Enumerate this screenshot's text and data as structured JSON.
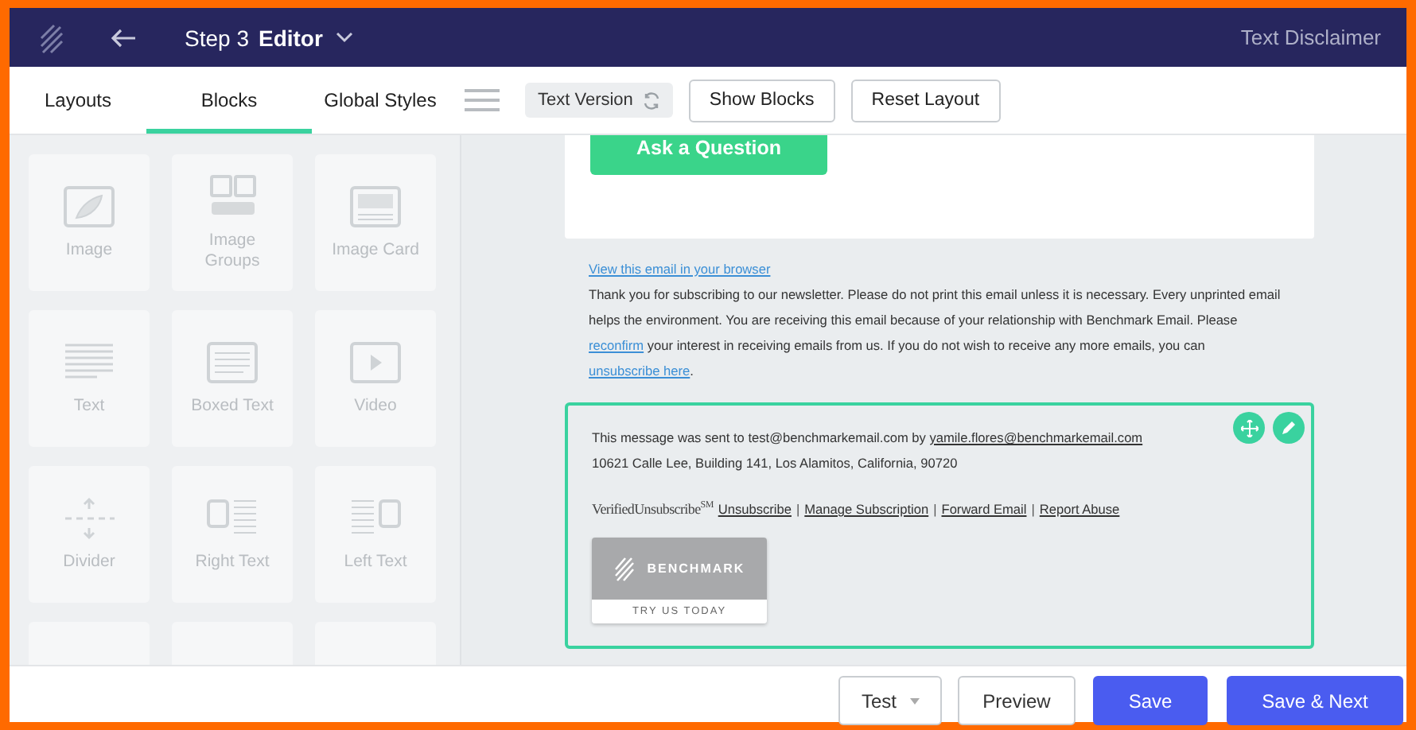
{
  "header": {
    "step": "Step 3",
    "title": "Editor",
    "right_label": "Text Disclaimer"
  },
  "tabs": [
    {
      "label": "Layouts",
      "selected": false
    },
    {
      "label": "Blocks",
      "selected": true
    },
    {
      "label": "Global Styles",
      "selected": false
    }
  ],
  "toolbar": {
    "text_version": "Text Version",
    "buttons": [
      "Show Blocks",
      "Reset Layout"
    ]
  },
  "blocks": [
    {
      "label": "Image",
      "kind": "image"
    },
    {
      "label": "Image Groups",
      "kind": "groups"
    },
    {
      "label": "Image Card",
      "kind": "card"
    },
    {
      "label": "Text",
      "kind": "text"
    },
    {
      "label": "Boxed Text",
      "kind": "boxed"
    },
    {
      "label": "Video",
      "kind": "video"
    },
    {
      "label": "Divider",
      "kind": "divider"
    },
    {
      "label": "Right Text",
      "kind": "right"
    },
    {
      "label": "Left Text",
      "kind": "left"
    },
    {
      "kind": "partial"
    },
    {
      "kind": "partial"
    },
    {
      "kind": "partial"
    }
  ],
  "email": {
    "cta": "Ask a Question",
    "notice": {
      "view_link": "View this email in your browser",
      "parts": [
        {
          "kind": "text",
          "text": "Thank you for subscribing to our newsletter. Please do not print this email unless it is necessary. Every unprinted email helps the environment. You are receiving this email because of your relationship with Benchmark Email. Please "
        },
        {
          "kind": "link",
          "text": "reconfirm"
        },
        {
          "kind": "text",
          "text": " your interest in receiving emails from us. If you do not wish to receive any more emails, you can "
        },
        {
          "kind": "link",
          "text": "unsubscribe here"
        },
        {
          "kind": "text",
          "text": "."
        }
      ]
    },
    "footer": {
      "sent_line": [
        {
          "kind": "text",
          "text": "This message was sent to test@benchmarkemail.com by "
        },
        {
          "kind": "link",
          "text": "yamile.flores@benchmarkemail.com"
        }
      ],
      "address": "10621 Calle Lee, Building 141, Los Alamitos, California, 90720",
      "verified": "VerifiedUnsubscribe",
      "verified_mark": "SM",
      "links": [
        "Unsubscribe",
        "Manage Subscription",
        "Forward Email",
        "Report Abuse"
      ],
      "separator": "|",
      "badge": {
        "brand": "BENCHMARK",
        "caption": "TRY US TODAY"
      }
    }
  },
  "footer_bar": {
    "test": "Test",
    "preview": "Preview",
    "save": "Save",
    "save_next": "Save & Next"
  }
}
